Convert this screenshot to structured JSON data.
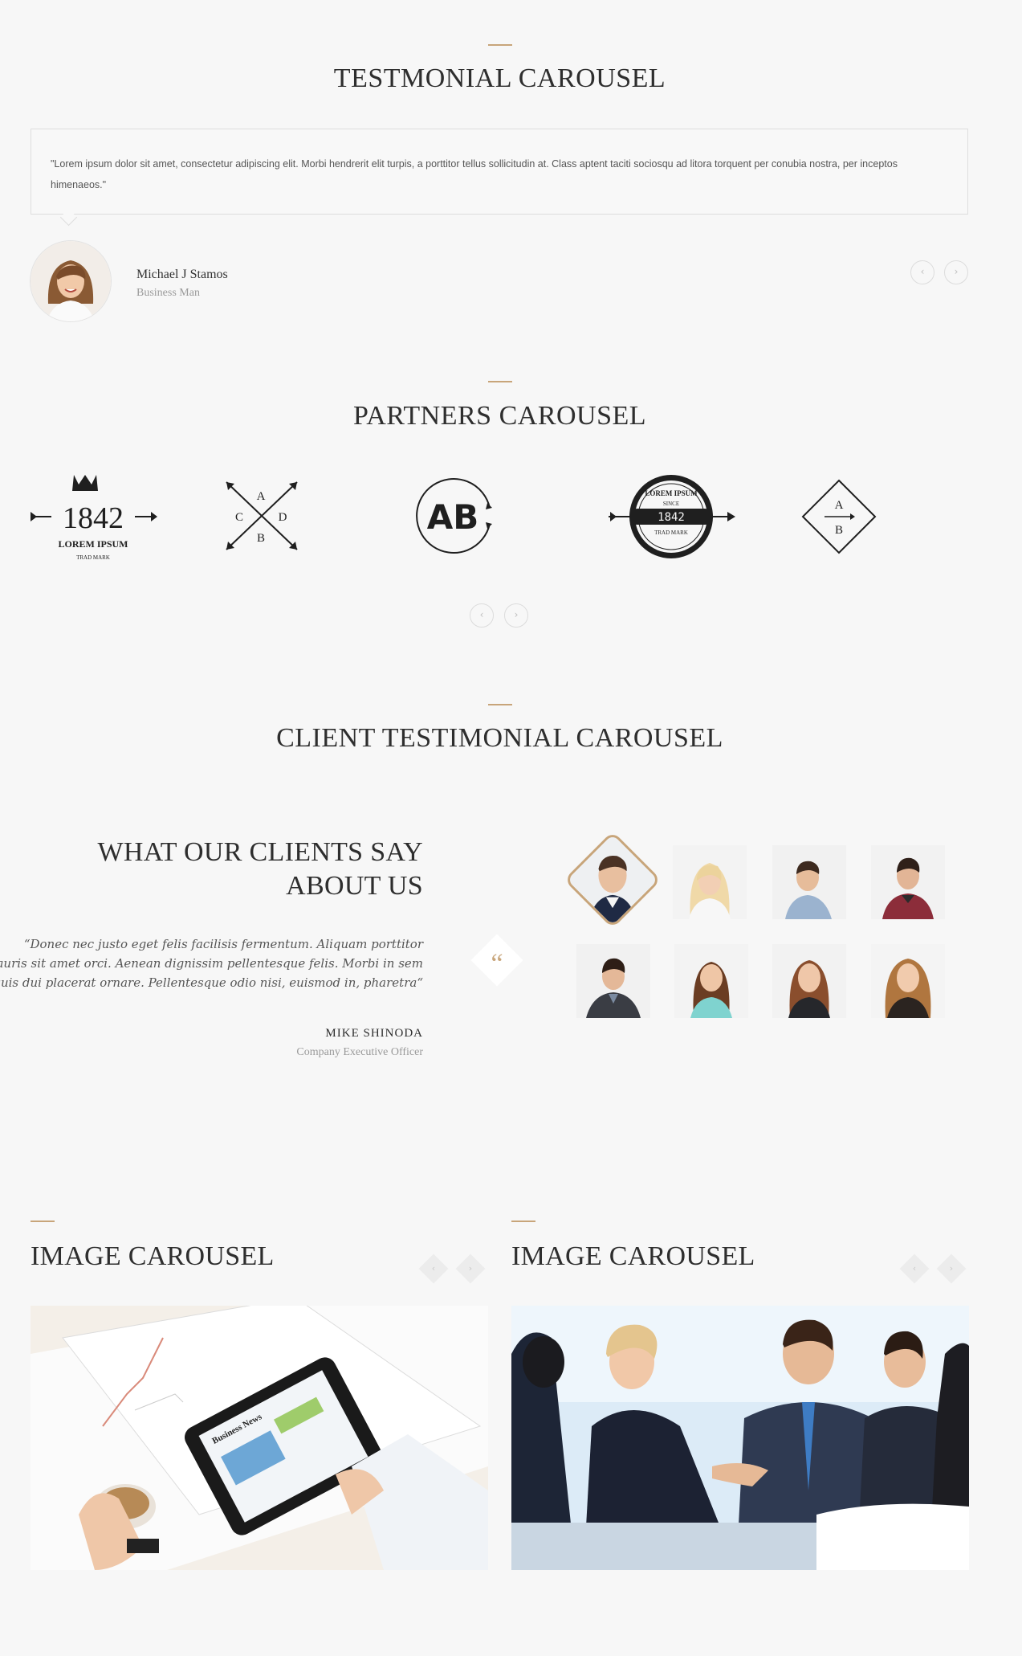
{
  "testimonial_section": {
    "title": "TESTMONIAL CAROUSEL",
    "quote": "\"Lorem ipsum dolor sit amet, consectetur adipiscing elit. Morbi hendrerit elit turpis, a porttitor tellus sollicitudin at. Class aptent taciti sociosqu ad litora torquent per conubia nostra, per inceptos himenaeos.\"",
    "author_name": "Michael J Stamos",
    "author_role": "Business Man",
    "prev_icon": "‹",
    "next_icon": "›"
  },
  "partners_section": {
    "title": "PARTNERS CAROUSEL",
    "logo1": {
      "number": "1842",
      "name": "LOREM IPSUM",
      "sub": "TRAD MARK"
    },
    "logo2": {
      "letters": [
        "A",
        "C",
        "D",
        "B"
      ]
    },
    "logo3": {
      "letters": "AB"
    },
    "logo4": {
      "arc": "LOREM IPSUM",
      "since": "SINCE",
      "number": "1842",
      "sub": "TRAD MARK"
    },
    "logo5": {
      "letters": [
        "A",
        "B"
      ]
    },
    "prev_icon": "‹",
    "next_icon": "›"
  },
  "client_section": {
    "title": "CLIENT TESTIMONIAL CAROUSEL",
    "heading_line1": "WHAT OUR CLIENTS SAY",
    "heading_line2": "ABOUT US",
    "quote_line1": "“Donec nec justo eget felis facilisis fermentum. Aliquam porttitor",
    "quote_line2": "mauris sit amet orci. Aenean dignissim pellentesque felis. Morbi in sem",
    "quote_line3": "quis dui placerat ornare. Pellentesque odio nisi, euismod in, pharetra“",
    "quote_mark": "“",
    "client_name": "MIKE SHINODA",
    "client_role": "Company Executive Officer"
  },
  "image_carousels": [
    {
      "title": "IMAGE CAROUSEL",
      "prev_icon": "‹",
      "next_icon": "›",
      "image": "tablet-business-news-image",
      "tablet_text": "Business News"
    },
    {
      "title": "IMAGE CAROUSEL",
      "prev_icon": "‹",
      "next_icon": "›",
      "image": "business-handshake-image"
    }
  ],
  "colors": {
    "accent": "#c8a57a",
    "background": "#f7f7f7",
    "text": "#2e2e2e"
  }
}
